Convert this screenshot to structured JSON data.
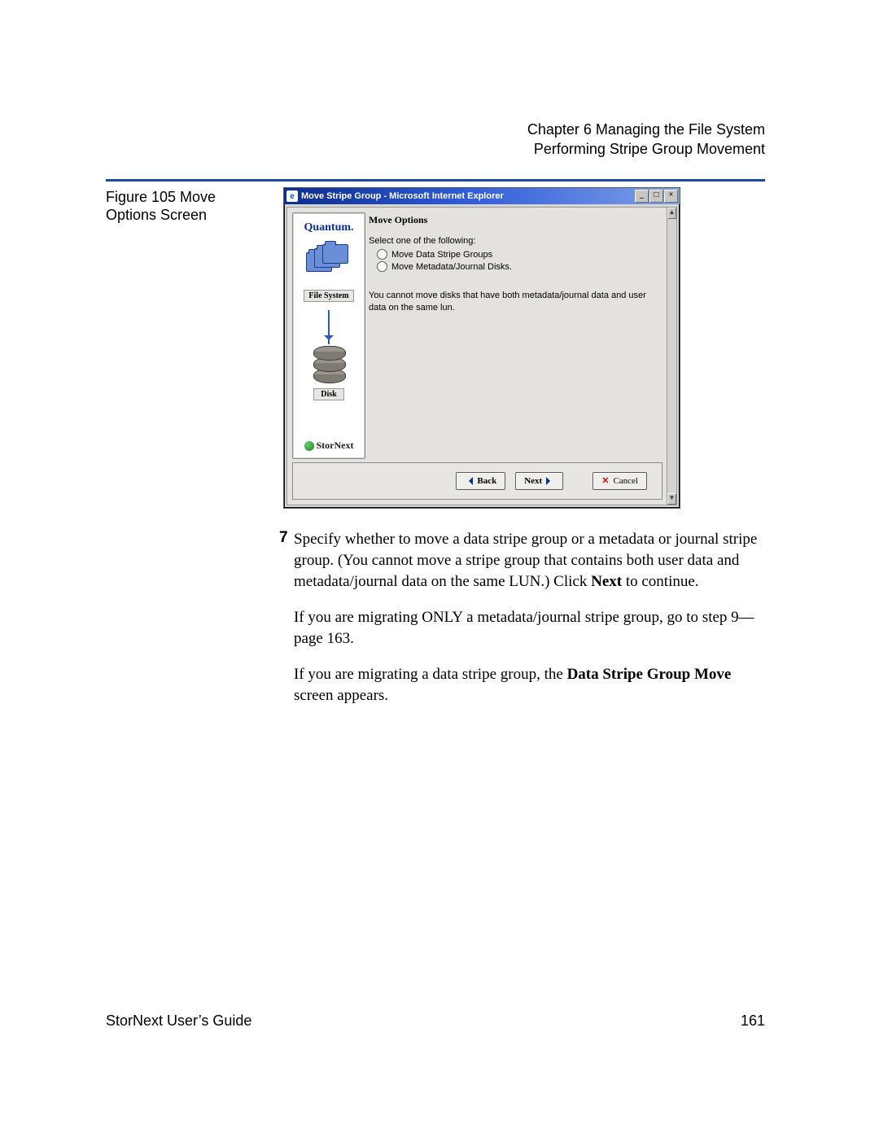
{
  "header": {
    "chapter": "Chapter 6  Managing the File System",
    "section": "Performing Stripe Group Movement"
  },
  "figure": {
    "caption": "Figure 105  Move Options Screen"
  },
  "screenshot": {
    "window_title": "Move Stripe Group - Microsoft Internet Explorer",
    "win_buttons": {
      "min": "_",
      "max": "□",
      "close": "×"
    },
    "scroll_up": "▲",
    "scroll_down": "▼",
    "sidebar": {
      "brand": "Quantum.",
      "fs_label": "File System",
      "disk_label": "Disk",
      "product": "StorNext"
    },
    "main": {
      "heading": "Move Options",
      "lead": "Select one of the following:",
      "opt1": "Move Data Stripe Groups",
      "opt2": "Move Metadata/Journal Disks.",
      "note": "You cannot move disks that have both metadata/journal data and user data on the same lun."
    },
    "buttons": {
      "back": "Back",
      "next": "Next",
      "cancel": "Cancel"
    }
  },
  "step": {
    "num": "7",
    "p1a": "Specify whether to move a data stripe group or a metadata or journal stripe group. (You cannot move a stripe group that contains both user data and metadata/journal data on the same LUN.) Click ",
    "p1b": "Next",
    "p1c": " to continue.",
    "p2": "If you are migrating ONLY a metadata/journal stripe group, go to step 9—page 163.",
    "p3a": "If you are migrating a data stripe group, the ",
    "p3b": "Data Stripe Group Move",
    "p3c": " screen appears."
  },
  "footer": {
    "left": "StorNext User’s Guide",
    "right": "161"
  }
}
